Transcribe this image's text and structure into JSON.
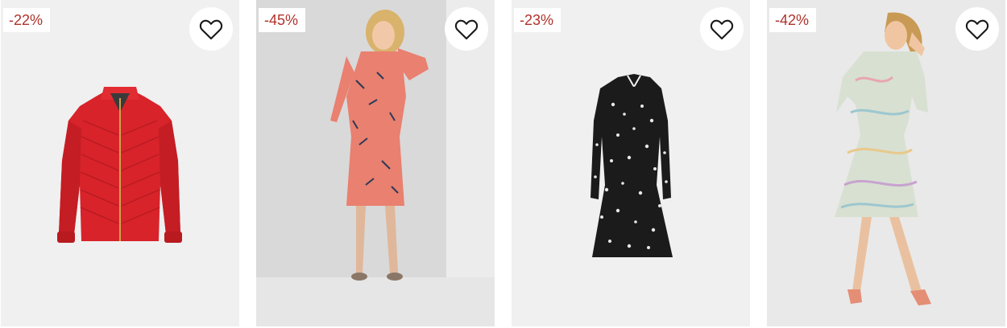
{
  "products": [
    {
      "discount": "-22%",
      "favorite_icon": "heart-outline-icon",
      "image_kind": "red-quilted-jacket"
    },
    {
      "discount": "-45%",
      "favorite_icon": "heart-outline-icon",
      "image_kind": "model-coral-print-dress"
    },
    {
      "discount": "-23%",
      "favorite_icon": "heart-outline-icon",
      "image_kind": "black-floral-dress"
    },
    {
      "discount": "-42%",
      "favorite_icon": "heart-outline-icon",
      "image_kind": "model-pastel-paisley-dress"
    }
  ],
  "colors": {
    "badge_text": "#b0322b",
    "badge_bg": "#ffffff",
    "card_bg": "#f0f0f0",
    "icon_stroke": "#1a1a1a"
  }
}
